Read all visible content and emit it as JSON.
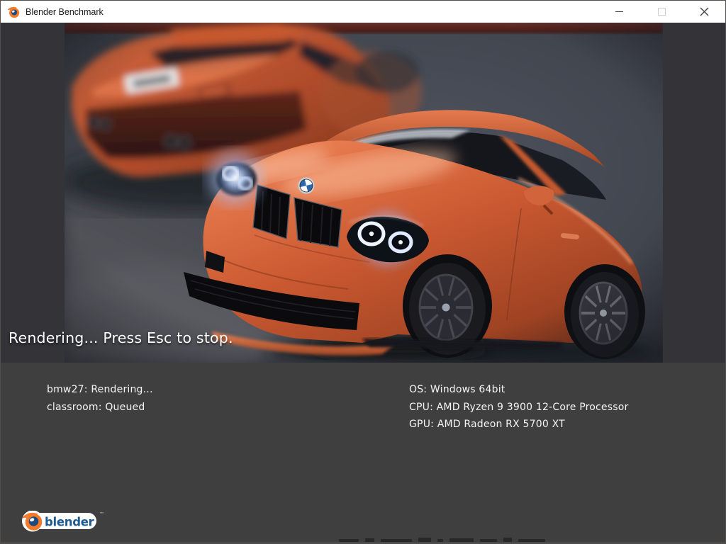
{
  "titlebar": {
    "title": "Blender Benchmark",
    "controls": {
      "minimize": "minimize",
      "maximize": "maximize-disabled",
      "close": "close"
    }
  },
  "render_view": {
    "overlay_status": "Rendering... Press Esc to stop."
  },
  "benchmark_queue": {
    "items": [
      {
        "scene": "bmw27",
        "status": "Rendering...",
        "line": "bmw27: Rendering..."
      },
      {
        "scene": "classroom",
        "status": "Queued",
        "line": "classroom: Queued"
      }
    ]
  },
  "system_info": {
    "os_line": "OS: Windows 64bit",
    "cpu_line": "CPU: AMD Ryzen 9 3900 12-Core Processor",
    "gpu_line": "GPU: AMD Radeon RX 5700 XT"
  },
  "footer": {
    "brand": "blender",
    "trademark": "™"
  },
  "icons": {
    "app_icon": "blender-logo-icon",
    "footer_logo": "blender-brand-logo"
  },
  "colors": {
    "titlebar_bg": "#ffffff",
    "content_bg": "#343438",
    "panel_bg": "#3f3f3f",
    "render_backdrop": "#40454f",
    "car_orange": "#cf5c36",
    "headlight_blue": "#cfe4ff",
    "blender_orange": "#f5792a",
    "blender_blue": "#1d5a93"
  }
}
